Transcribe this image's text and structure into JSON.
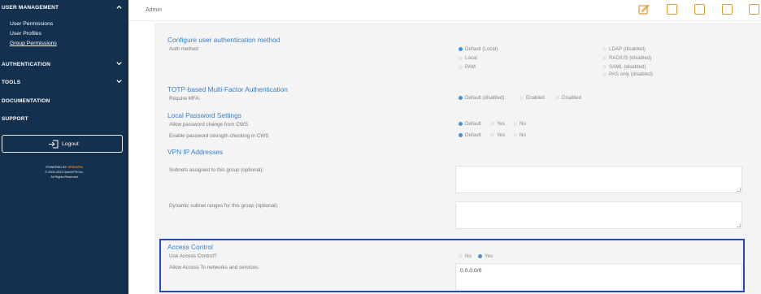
{
  "sidebar": {
    "user_management": "USER MANAGEMENT",
    "sub_items": [
      "User Permissions",
      "User Profiles",
      "Group Permissions"
    ],
    "authentication": "AUTHENTICATION",
    "tools": "TOOLS",
    "documentation": "DOCUMENTATION",
    "support": "SUPPORT",
    "logout": "Logout",
    "powered_by": "POWERED BY",
    "brand": "OPENVPN",
    "copyright": "© 2009-2023 OpenVPN Inc.",
    "rights": "All Rights Reserved"
  },
  "header": {
    "breadcrumb": "Admin",
    "edit_icon": "edit-icon",
    "icon_color": "#e09a3a"
  },
  "auth_method": {
    "title": "Configure user authentication method",
    "label": "Auth method",
    "options_left": [
      "Default (Local)",
      "Local",
      "PAM"
    ],
    "options_right": [
      "LDAP (disabled)",
      "RADIUS (disabled)",
      "SAML (disabled)",
      "PAS only (disabled)"
    ],
    "selected": "Default (Local)"
  },
  "mfa": {
    "title": "TOTP-based Multi-Factor Authentication",
    "label": "Require MFA:",
    "options": [
      "Default (disabled)",
      "Enabled",
      "Disabled"
    ],
    "selected": "Default (disabled)"
  },
  "password": {
    "title": "Local Password Settings",
    "change_label": "Allow password change from CWS",
    "strength_label": "Enable password strength checking in CWS",
    "options": [
      "Default",
      "Yes",
      "No"
    ],
    "selected": "Default"
  },
  "vpn": {
    "title": "VPN IP Addresses",
    "subnets_label": "Subnets assigned to this group (optional):",
    "dynamic_label": "Dynamic subnet ranges for this group (optional):"
  },
  "access": {
    "title": "Access Control",
    "use_label": "Use Access Control?",
    "options": [
      "No",
      "Yes"
    ],
    "selected": "Yes",
    "allow_label": "Allow Access To networks and services:",
    "allow_value": "0.0.0.0/0"
  },
  "colors": {
    "sidebar": "#14304f",
    "accent": "#3a7ec6",
    "highlight_border": "#2a48c2"
  }
}
